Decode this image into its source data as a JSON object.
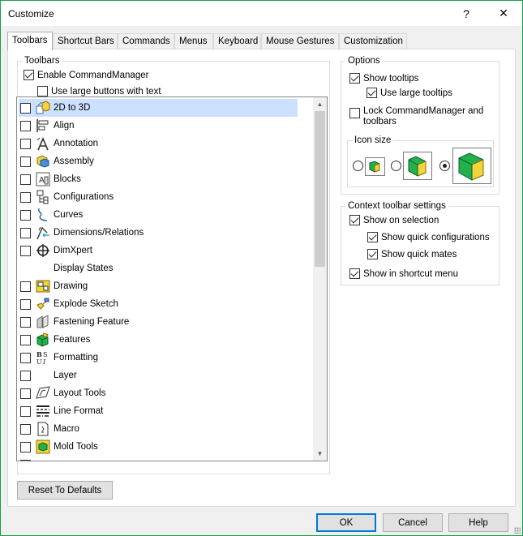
{
  "window": {
    "title": "Customize",
    "help_glyph": "?",
    "close_glyph": "✕"
  },
  "tabs": [
    {
      "label": "Toolbars",
      "active": true
    },
    {
      "label": "Shortcut Bars"
    },
    {
      "label": "Commands"
    },
    {
      "label": "Menus"
    },
    {
      "label": "Keyboard"
    },
    {
      "label": "Mouse Gestures"
    },
    {
      "label": "Customization"
    }
  ],
  "toolbars_group": {
    "legend": "Toolbars",
    "enable_commandmanager": {
      "label": "Enable CommandManager",
      "checked": true
    },
    "use_large_buttons": {
      "label": "Use large buttons with text",
      "checked": false
    },
    "items": [
      {
        "label": "2D to 3D",
        "icon": "2d-to-3d-icon",
        "checked": false,
        "selected": true
      },
      {
        "label": "Align",
        "icon": "align-icon",
        "checked": false
      },
      {
        "label": "Annotation",
        "icon": "annotation-icon",
        "checked": false
      },
      {
        "label": "Assembly",
        "icon": "assembly-icon",
        "checked": false
      },
      {
        "label": "Blocks",
        "icon": "blocks-icon",
        "checked": false
      },
      {
        "label": "Configurations",
        "icon": "configurations-icon",
        "checked": false
      },
      {
        "label": "Curves",
        "icon": "curves-icon",
        "checked": false
      },
      {
        "label": "Dimensions/Relations",
        "icon": "dimensions-relations-icon",
        "checked": false
      },
      {
        "label": "DimXpert",
        "icon": "dimxpert-icon",
        "checked": false
      },
      {
        "label": "Display States",
        "icon": "",
        "checked": false,
        "no_checkbox": true
      },
      {
        "label": "Drawing",
        "icon": "drawing-icon",
        "checked": false
      },
      {
        "label": "Explode Sketch",
        "icon": "explode-sketch-icon",
        "checked": false
      },
      {
        "label": "Fastening Feature",
        "icon": "fastening-feature-icon",
        "checked": false
      },
      {
        "label": "Features",
        "icon": "features-icon",
        "checked": false
      },
      {
        "label": "Formatting",
        "icon": "formatting-icon",
        "checked": false
      },
      {
        "label": "Layer",
        "icon": "",
        "checked": false
      },
      {
        "label": "Layout Tools",
        "icon": "layout-tools-icon",
        "checked": false
      },
      {
        "label": "Line Format",
        "icon": "line-format-icon",
        "checked": false
      },
      {
        "label": "Macro",
        "icon": "macro-icon",
        "checked": false
      },
      {
        "label": "Mold Tools",
        "icon": "mold-tools-icon",
        "checked": false
      }
    ]
  },
  "options_group": {
    "legend": "Options",
    "show_tooltips": {
      "label": "Show tooltips",
      "checked": true
    },
    "use_large_tooltips": {
      "label": "Use large tooltips",
      "checked": true
    },
    "lock_commandmanager_line1": "Lock CommandManager and",
    "lock_commandmanager_line2": "toolbars",
    "lock_commandmanager_checked": false,
    "icon_size": {
      "legend": "Icon size",
      "selected": "large",
      "options": [
        "small",
        "medium",
        "large"
      ]
    }
  },
  "context_group": {
    "legend": "Context toolbar settings",
    "show_on_selection": {
      "label": "Show on selection",
      "checked": true
    },
    "show_quick_configurations": {
      "label": "Show quick configurations",
      "checked": true
    },
    "show_quick_mates": {
      "label": "Show quick mates",
      "checked": true
    },
    "show_in_shortcut_menu": {
      "label": "Show in shortcut menu",
      "checked": true
    }
  },
  "buttons": {
    "reset": "Reset To Defaults",
    "ok": "OK",
    "cancel": "Cancel",
    "help": "Help"
  },
  "colors": {
    "selection": "#cce0ff",
    "window_border": "#18a04a",
    "default_button": "#0078d7",
    "icon_green": "#22b14c",
    "icon_yellow": "#f2d53c"
  }
}
